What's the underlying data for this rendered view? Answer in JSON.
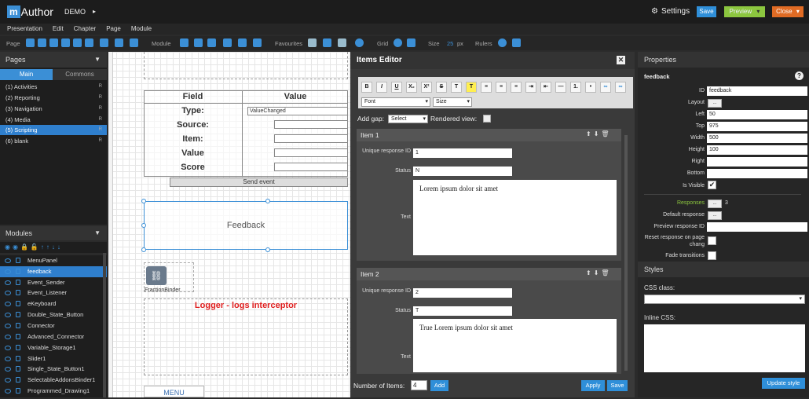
{
  "app": {
    "logo_m": "m",
    "logo_text": "Author",
    "project": "DEMO",
    "play": "▸",
    "settings": "Settings",
    "save": "Save",
    "preview": "Preview",
    "close": "Close",
    "preview_arrow": "▾",
    "close_arrow": "▾"
  },
  "menu": [
    "Presentation",
    "Edit",
    "Chapter",
    "Page",
    "Module"
  ],
  "toolbar": {
    "page": "Page",
    "module": "Module",
    "favourites": "Favourites",
    "grid": "Grid",
    "size": "Size",
    "size_value": "25",
    "size_unit": "px",
    "rulers": "Rulers"
  },
  "pages": {
    "title": "Pages",
    "tabs": [
      "Main",
      "Commons"
    ],
    "items": [
      {
        "label": "(1) Activities",
        "flag": "R"
      },
      {
        "label": "(2) Reporting",
        "flag": "R"
      },
      {
        "label": "(3) Navigation",
        "flag": "R"
      },
      {
        "label": "(4) Media",
        "flag": "R"
      },
      {
        "label": "(5) Scripting",
        "flag": "R"
      },
      {
        "label": "(6) blank",
        "flag": "R"
      }
    ]
  },
  "modules": {
    "title": "Modules",
    "items": [
      "MenuPanel",
      "feedback",
      "Event_Sender",
      "Event_Listener",
      "eKeyboard",
      "Double_State_Button",
      "Connector",
      "Advanced_Connector",
      "Variable_Storage1",
      "Slider1",
      "Single_State_Button1",
      "SelectableAddonsBinder1",
      "Programmed_Drawing1"
    ]
  },
  "canvas": {
    "col_field": "Field",
    "col_value": "Value",
    "rows": [
      "Type:",
      "Source:",
      "Item:",
      "Value",
      "Score"
    ],
    "type_value": "ValueChanged",
    "send_event": "Send event",
    "feedback": "Feedback",
    "binder_label": "FractionBinder",
    "logger": "Logger - logs interceptor",
    "menu": "MENU"
  },
  "items_editor": {
    "title": "Items Editor",
    "close": "✕",
    "font": "Font",
    "size": "Size",
    "add_gap_label": "Add gap:",
    "add_gap_value": "Select",
    "rendered_view": "Rendered view:",
    "items": [
      {
        "title": "Item 1",
        "unique_label": "Unique response ID",
        "unique_value": "1",
        "status_label": "Status",
        "status_value": "N",
        "text_label": "Text",
        "text": "Lorem ipsum dolor sit amet"
      },
      {
        "title": "Item 2",
        "unique_label": "Unique response ID",
        "unique_value": "2",
        "status_label": "Status",
        "status_value": "T",
        "text_label": "Text",
        "text": "True Lorem ipsum dolor sit amet"
      }
    ],
    "num_items_label": "Number of Items:",
    "num_items_value": "4",
    "add": "Add",
    "apply": "Apply",
    "save": "Save"
  },
  "properties": {
    "title": "Properties",
    "module": "feedback",
    "help": "?",
    "fields": [
      {
        "label": "ID",
        "value": "feedback"
      },
      {
        "label": "Layout",
        "value": "..."
      },
      {
        "label": "Left",
        "value": "50"
      },
      {
        "label": "Top",
        "value": "975"
      },
      {
        "label": "Width",
        "value": "500"
      },
      {
        "label": "Height",
        "value": "100"
      },
      {
        "label": "Right",
        "value": ""
      },
      {
        "label": "Bottom",
        "value": ""
      },
      {
        "label": "Is Visible",
        "value": "✔"
      }
    ],
    "responses_label": "Responses",
    "responses_btn": "...",
    "responses_count": "3",
    "default_response": "Default response",
    "default_btn": "...",
    "preview_response_id": "Preview response ID",
    "reset_response": "Reset response on page chang",
    "fade": "Fade transitions",
    "styles": "Styles",
    "css_class": "CSS class:",
    "inline_css": "Inline CSS:",
    "update_style": "Update style"
  },
  "colors": {
    "accent": "#3b8fd6",
    "preview": "#8cc63f",
    "close": "#e06b24",
    "logger": "#e02020"
  }
}
